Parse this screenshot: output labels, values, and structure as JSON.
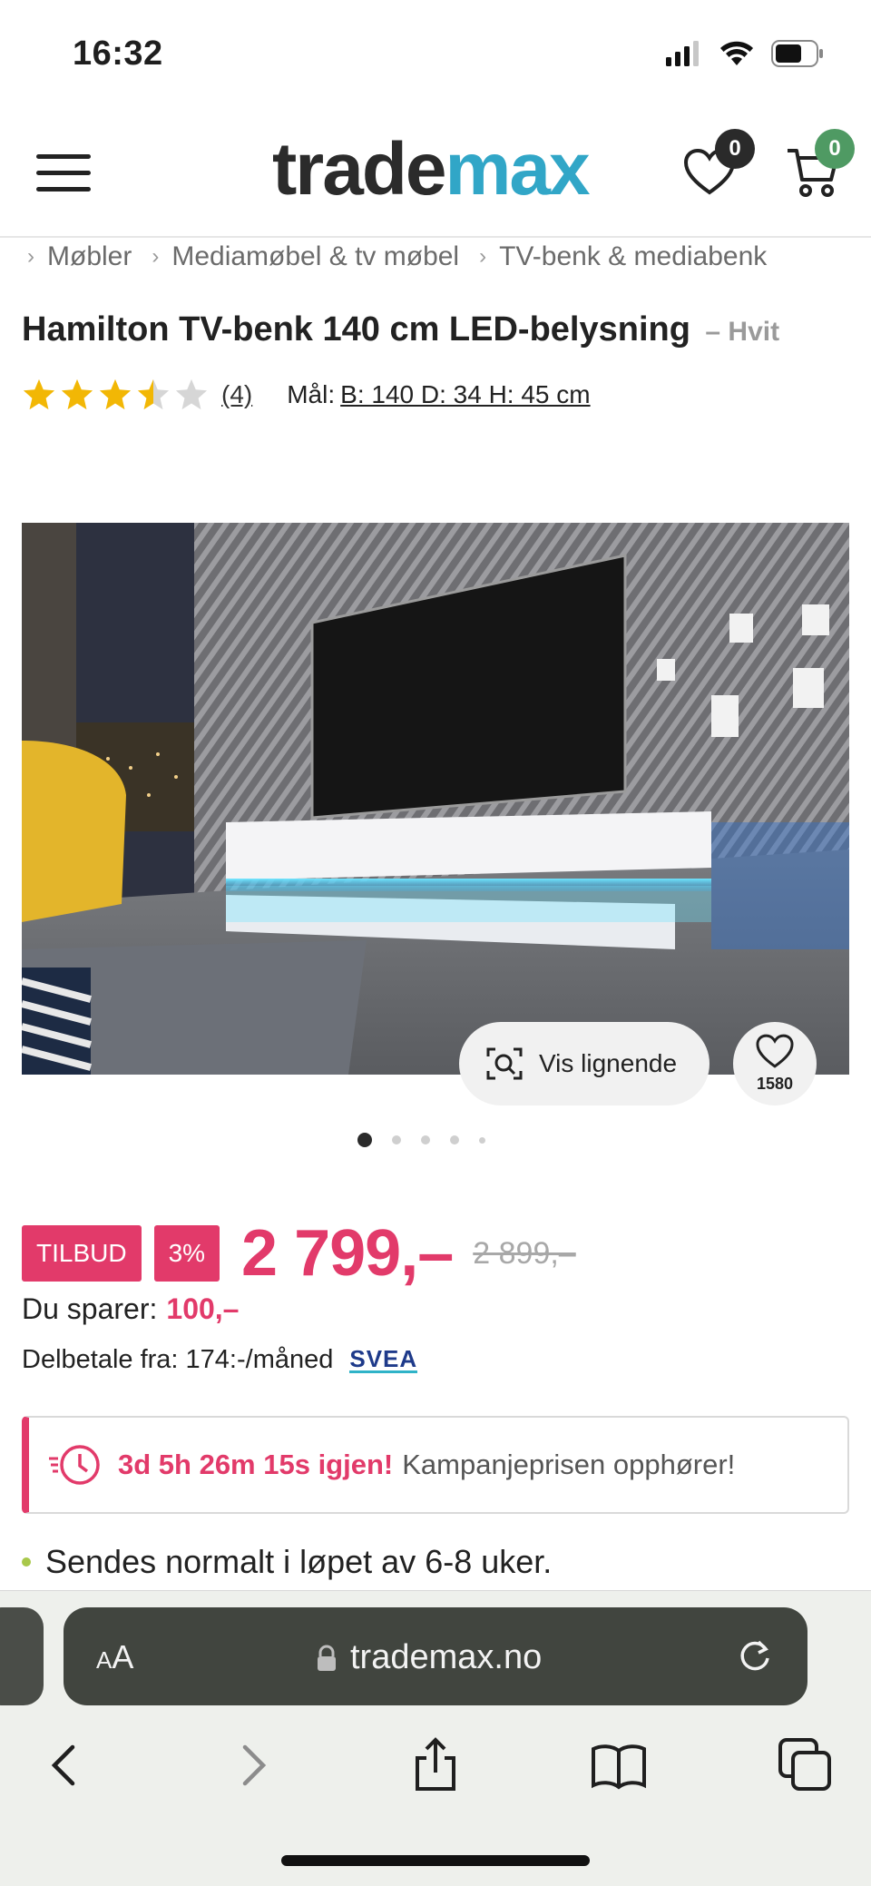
{
  "status_bar": {
    "time": "16:32"
  },
  "header": {
    "logo_part1": "trade",
    "logo_part2": "max",
    "wishlist_count": "0",
    "cart_count": "0"
  },
  "breadcrumb": [
    "Møbler",
    "Mediamøbel & tv møbel",
    "TV-benk & mediabenk"
  ],
  "product": {
    "title": "Hamilton TV-benk 140 cm LED-belysning",
    "variant": "– Hvit",
    "rating": 3.5,
    "review_count": "(4)",
    "dims_label": "Mål:",
    "dims_value": "B: 140 D: 34 H: 45 cm",
    "similar_label": "Vis lignende",
    "favorites_count": "1580",
    "gallery_active_index": 0
  },
  "pricing": {
    "tag_offer": "TILBUD",
    "tag_discount": "3%",
    "price": "2 799,–",
    "old_price": "2 899,–",
    "savings_label": "Du sparer:",
    "savings_value": "100,–",
    "installment_text": "Delbetale fra: 174:-/måned",
    "installment_provider": "SVEA"
  },
  "campaign": {
    "countdown": "3d 5h 26m 15s igjen!",
    "text": "Kampanjeprisen opphører!"
  },
  "shipping": "Sendes normalt i løpet av 6-8 uker.",
  "browser": {
    "aa_label_small": "A",
    "aa_label_large": "A",
    "url": "trademax.no"
  },
  "colors": {
    "accent": "#e23a6a",
    "brand_blue": "#31a6c7",
    "rating_star": "#f2b705"
  }
}
